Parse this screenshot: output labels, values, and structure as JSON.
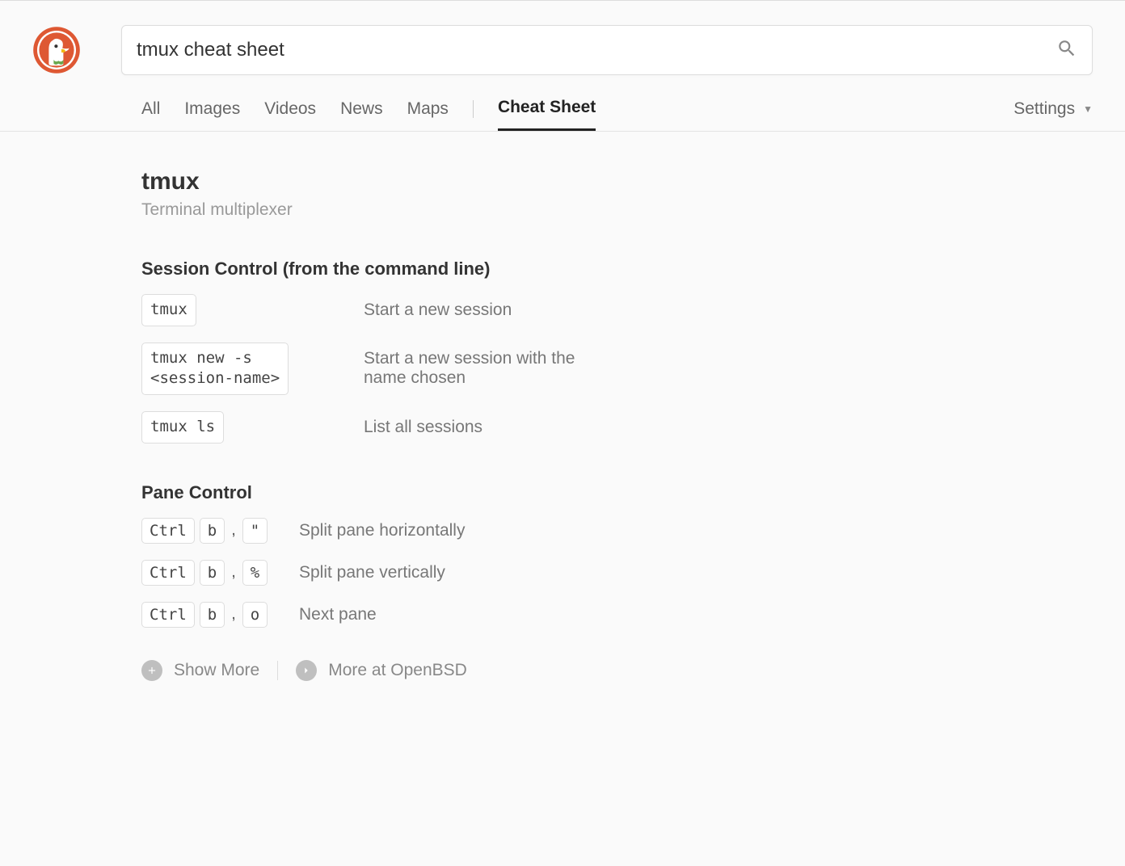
{
  "search": {
    "query": "tmux cheat sheet"
  },
  "tabs": {
    "all": "All",
    "images": "Images",
    "videos": "Videos",
    "news": "News",
    "maps": "Maps",
    "cheat": "Cheat Sheet"
  },
  "settings_label": "Settings",
  "sheet": {
    "title": "tmux",
    "subtitle": "Terminal multiplexer",
    "sections": [
      {
        "heading": "Session Control (from the command line)",
        "rows": [
          {
            "cmd": "tmux",
            "desc": "Start a new session"
          },
          {
            "cmd": "tmux new -s\n<session-name>",
            "desc": "Start a new session with the name chosen"
          },
          {
            "cmd": "tmux ls",
            "desc": "List all sessions"
          }
        ]
      },
      {
        "heading": "Pane Control",
        "rows": [
          {
            "keys": [
              "Ctrl",
              "b",
              "\""
            ],
            "desc": "Split pane horizontally"
          },
          {
            "keys": [
              "Ctrl",
              "b",
              "%"
            ],
            "desc": "Split pane vertically"
          },
          {
            "keys": [
              "Ctrl",
              "b",
              "o"
            ],
            "desc": "Next pane"
          }
        ]
      }
    ]
  },
  "footer": {
    "show_more": "Show More",
    "more_at": "More at OpenBSD"
  }
}
